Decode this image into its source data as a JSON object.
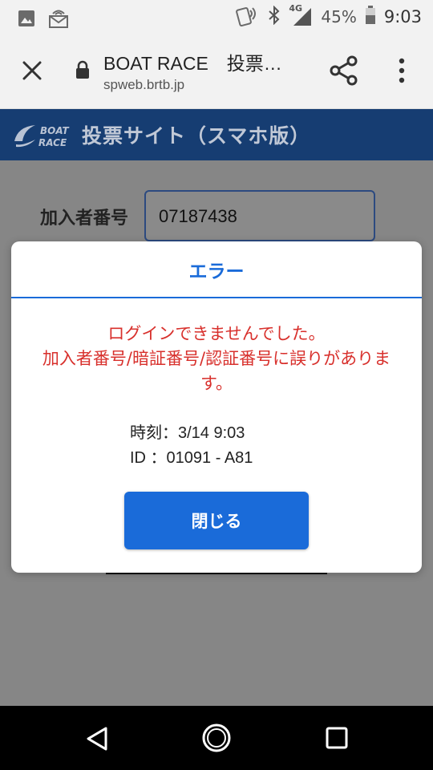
{
  "status_bar": {
    "network": "4G",
    "battery": "45%",
    "time": "9:03"
  },
  "browser": {
    "title": "BOAT RACE　投票…",
    "url": "spweb.brtb.jp"
  },
  "site": {
    "logo_line1": "BOAT",
    "logo_line2": "RACE",
    "title": "投票サイト（スマホ版）"
  },
  "form": {
    "member_label": "加入者番号",
    "member_value": "07187438"
  },
  "dialog": {
    "title": "エラー",
    "message_line1": "ログインできませんでした。",
    "message_line2": "加入者番号/暗証番号/認証番号に誤りがありま",
    "message_line3": "す。",
    "time_line": "時刻：3/14 9:03",
    "id_line": "ID ：01091 - A81",
    "close_label": "閉じる"
  },
  "colors": {
    "header_bg": "#163d72",
    "accent": "#1a6bd9",
    "error_text": "#d8302c",
    "overlay": "#868686"
  },
  "icons": {
    "status_left": [
      "image-icon",
      "mail-icon"
    ],
    "status_right": [
      "nfc-icon",
      "bluetooth-icon",
      "signal-icon",
      "battery-icon"
    ],
    "browser": [
      "close-icon",
      "lock-icon",
      "share-icon",
      "more-vert-icon"
    ],
    "nav": [
      "back-icon",
      "home-icon",
      "recent-apps-icon"
    ]
  }
}
